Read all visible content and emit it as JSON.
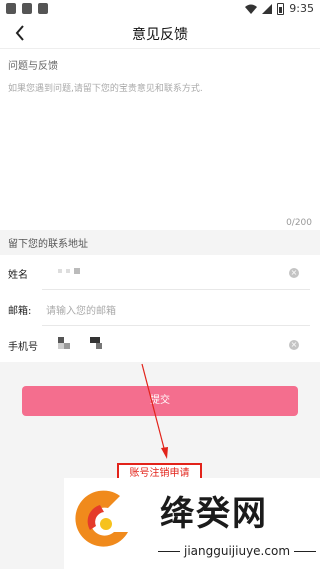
{
  "status_bar": {
    "time": "9:35"
  },
  "nav": {
    "title": "意见反馈",
    "back_icon": "chevron-left-icon"
  },
  "feedback": {
    "label": "问题与反馈",
    "placeholder": "如果您遇到问题,请留下您的宝贵意见和联系方式.",
    "char_count": "0/200"
  },
  "contact": {
    "header": "留下您的联系地址",
    "name_label": "姓名",
    "email_label": "邮箱:",
    "email_placeholder": "请输入您的邮箱",
    "phone_label": "手机号"
  },
  "submit_label": "提交",
  "annotation_label": "账号注销申请",
  "watermark": {
    "title": "绛癸网",
    "url": "jiangguijiuye.com"
  },
  "colors": {
    "accent": "#f46e8e",
    "annotation": "#e2231a"
  }
}
